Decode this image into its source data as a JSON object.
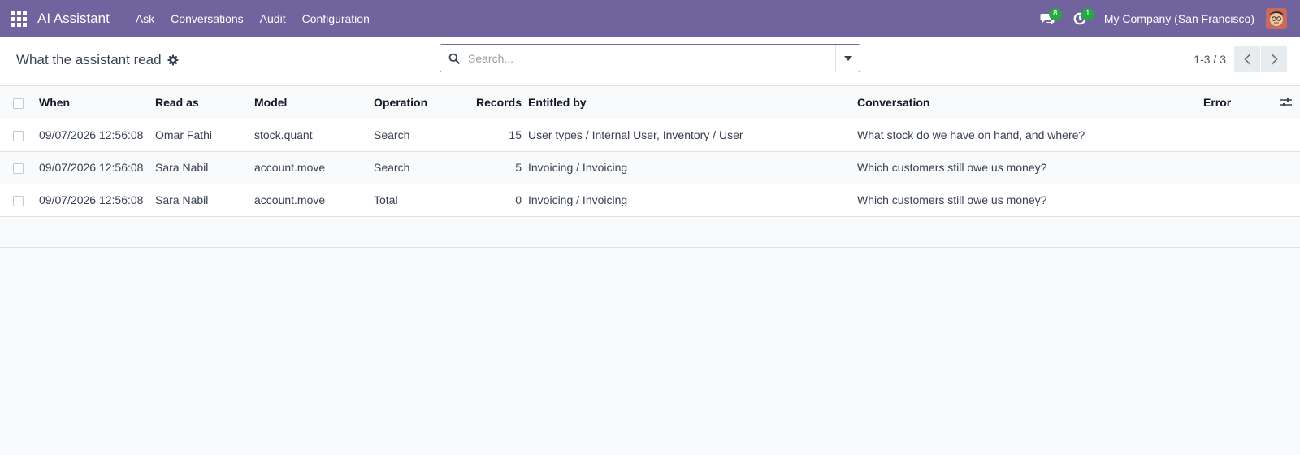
{
  "navbar": {
    "app_name": "AI Assistant",
    "menu": [
      "Ask",
      "Conversations",
      "Audit",
      "Configuration"
    ],
    "messages_count": "8",
    "activities_count": "1",
    "company": "My Company (San Francisco)",
    "color": "#71639e"
  },
  "control": {
    "title": "What the assistant read",
    "search_placeholder": "Search...",
    "pager": "1-3 / 3"
  },
  "table": {
    "columns": [
      "When",
      "Read as",
      "Model",
      "Operation",
      "Records",
      "Entitled by",
      "Conversation",
      "Error"
    ],
    "rows": [
      {
        "when": "09/07/2026 12:56:08",
        "read_as": "Omar Fathi",
        "model": "stock.quant",
        "operation": "Search",
        "records": "15",
        "entitled_by": "User types / Internal User, Inventory / User",
        "conversation": "What stock do we have on hand, and where?",
        "error": ""
      },
      {
        "when": "09/07/2026 12:56:08",
        "read_as": "Sara Nabil",
        "model": "account.move",
        "operation": "Search",
        "records": "5",
        "entitled_by": "Invoicing / Invoicing",
        "conversation": "Which customers still owe us money?",
        "error": ""
      },
      {
        "when": "09/07/2026 12:56:08",
        "read_as": "Sara Nabil",
        "model": "account.move",
        "operation": "Total",
        "records": "0",
        "entitled_by": "Invoicing / Invoicing",
        "conversation": "Which customers still owe us money?",
        "error": ""
      }
    ]
  }
}
